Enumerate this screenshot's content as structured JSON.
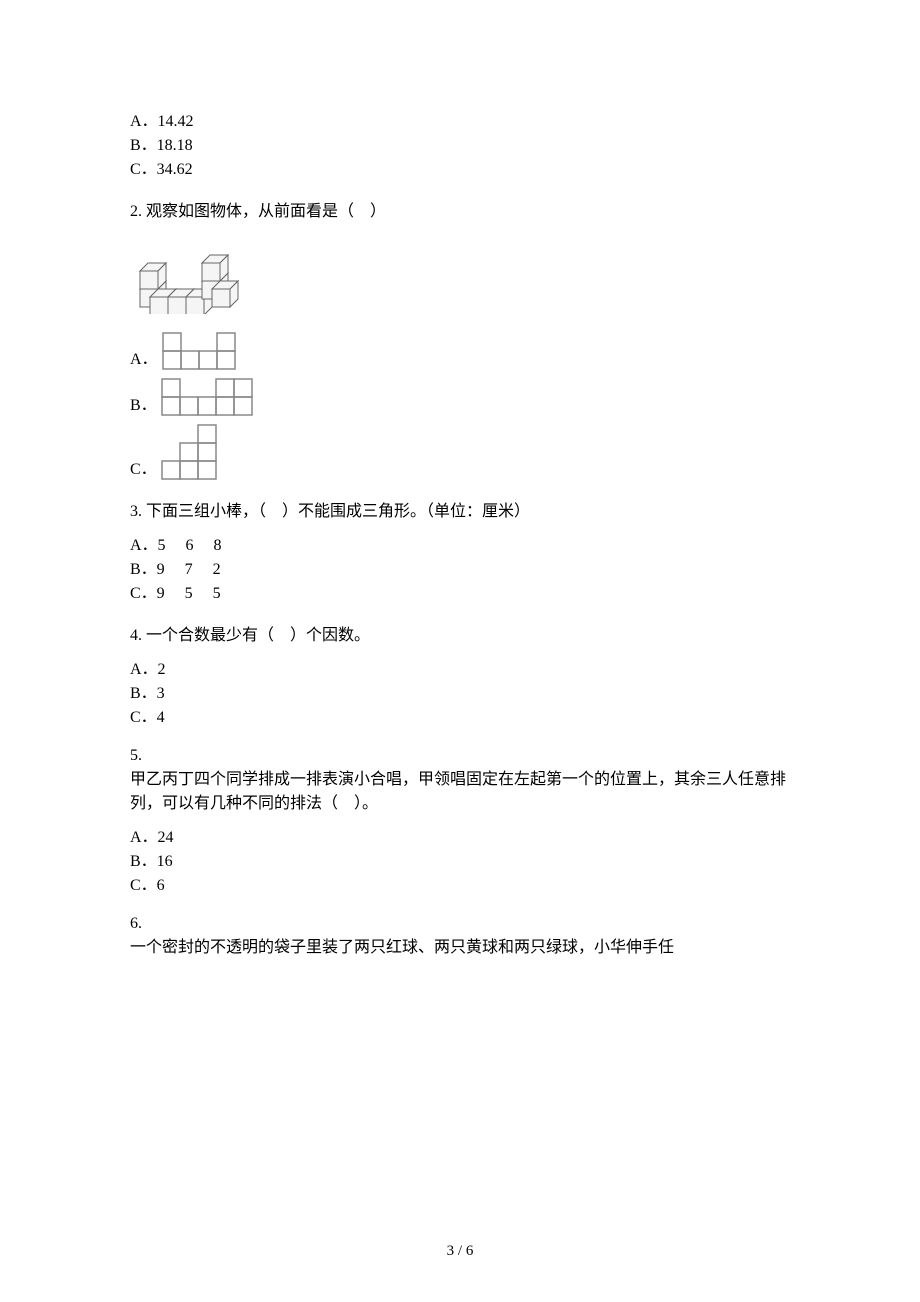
{
  "q1": {
    "A": "A．14.42",
    "B": "B．18.18",
    "C": "C．34.62"
  },
  "q2": {
    "stem": "2. 观察如图物体，从前面看是（ ）",
    "A": "A．",
    "B": "B．",
    "C": "C．"
  },
  "q3": {
    "stem": "3. 下面三组小棒，（ ）不能围成三角形。（单位：厘米）",
    "A": "A．5  6  8",
    "B": "B．9  7  2",
    "C": "C．9  5  5"
  },
  "q4": {
    "stem": "4. 一个合数最少有（ ）个因数。",
    "A": "A．2",
    "B": "B．3",
    "C": "C．4"
  },
  "q5": {
    "num": "5.",
    "stem": "甲乙丙丁四个同学排成一排表演小合唱，甲领唱固定在左起第一个的位置上，其余三人任意排列，可以有几种不同的排法（ ）。",
    "A": "A．24",
    "B": "B．16",
    "C": "C．6"
  },
  "q6": {
    "num": "6.",
    "stem": "一个密封的不透明的袋子里装了两只红球、两只黄球和两只绿球，小华伸手任"
  },
  "footer": "3 / 6"
}
